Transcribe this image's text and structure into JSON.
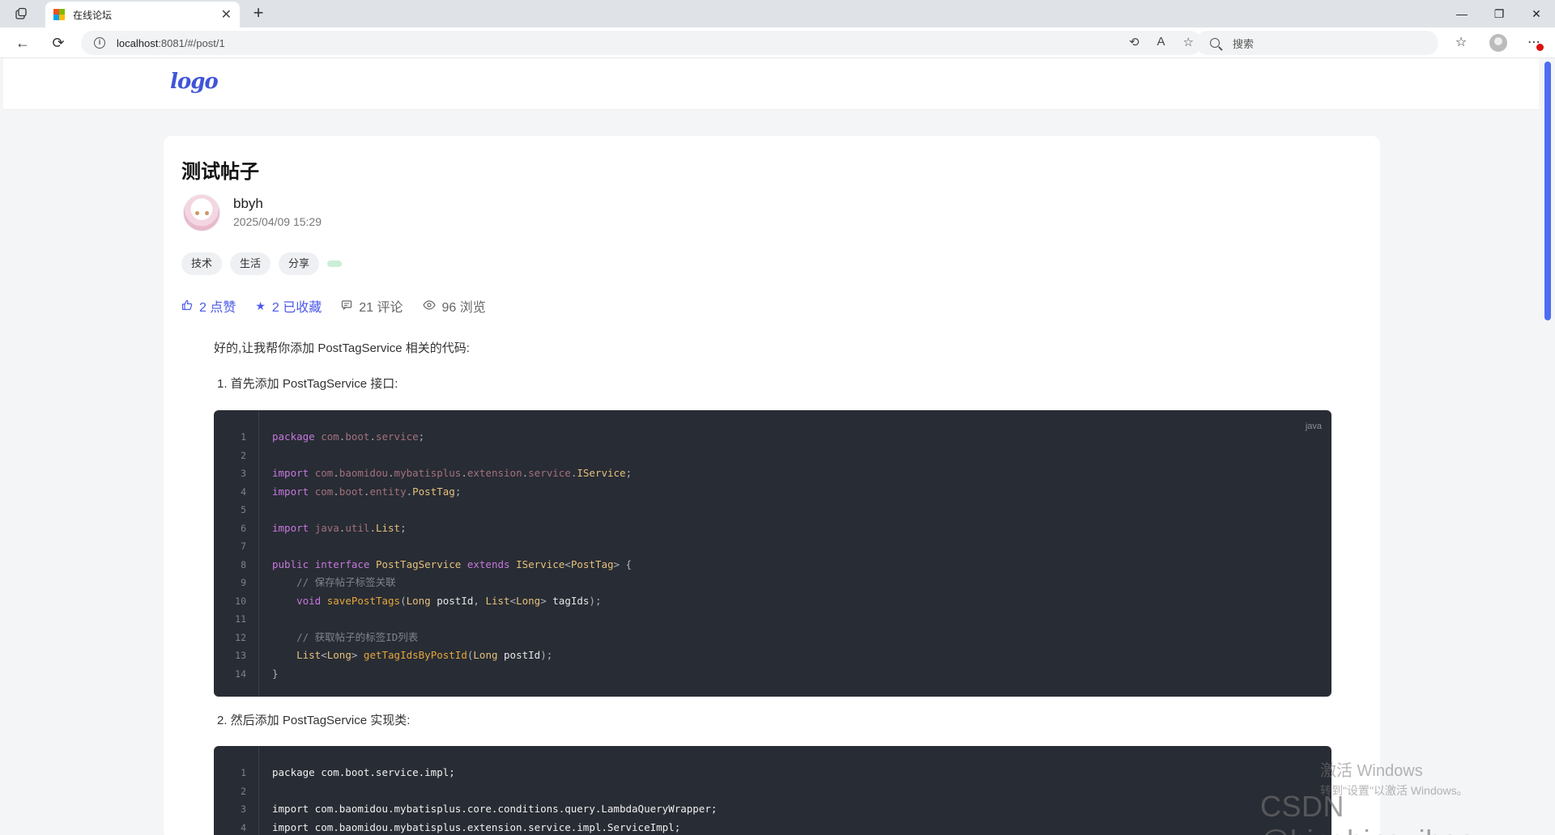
{
  "browser": {
    "tab_title": "在线论坛",
    "url_host": "localhost",
    "url_rest": ":8081/#/post/1",
    "search_placeholder": "搜索"
  },
  "site": {
    "logo": "logo"
  },
  "post": {
    "title": "测试帖子",
    "author": "bbyh",
    "date": "2025/04/09 15:29",
    "tags": [
      "技术",
      "生活",
      "分享"
    ],
    "stats": {
      "likes": "2 点赞",
      "favorites": "2 已收藏",
      "comments": "21 评论",
      "views": "96 浏览"
    },
    "intro": "好的,让我帮你添加 PostTagService 相关的代码:",
    "step1": "1. 首先添加 PostTagService 接口:",
    "code1_lang": "java",
    "code1_lines": [
      {
        "n": "1",
        "t": "package com.boot.service;"
      },
      {
        "n": "2",
        "t": ""
      },
      {
        "n": "3",
        "t": "import com.baomidou.mybatisplus.extension.service.IService;"
      },
      {
        "n": "4",
        "t": "import com.boot.entity.PostTag;"
      },
      {
        "n": "5",
        "t": ""
      },
      {
        "n": "6",
        "t": "import java.util.List;"
      },
      {
        "n": "7",
        "t": ""
      },
      {
        "n": "8",
        "t": "public interface PostTagService extends IService<PostTag> {"
      },
      {
        "n": "9",
        "t": "    // 保存帖子标签关联"
      },
      {
        "n": "10",
        "t": "    void savePostTags(Long postId, List<Long> tagIds);"
      },
      {
        "n": "11",
        "t": ""
      },
      {
        "n": "12",
        "t": "    // 获取帖子的标签ID列表"
      },
      {
        "n": "13",
        "t": "    List<Long> getTagIdsByPostId(Long postId);"
      },
      {
        "n": "14",
        "t": "}"
      }
    ],
    "step2": "2. 然后添加 PostTagService 实现类:",
    "code2_lines": [
      {
        "n": "1",
        "t": "package com.boot.service.impl;"
      },
      {
        "n": "2",
        "t": ""
      },
      {
        "n": "3",
        "t": "import com.baomidou.mybatisplus.core.conditions.query.LambdaQueryWrapper;"
      },
      {
        "n": "4",
        "t": "import com.baomidou.mybatisplus.extension.service.impl.ServiceImpl;"
      }
    ]
  },
  "overlay": {
    "activate_title": "激活 Windows",
    "activate_sub": "转到\"设置\"以激活 Windows。",
    "csdn": "CSDN @bingbingyihao"
  },
  "colors": {
    "accent": "#4c5ae8",
    "code_bg": "#282c34",
    "scroll_thumb": "#4e6ef2"
  }
}
